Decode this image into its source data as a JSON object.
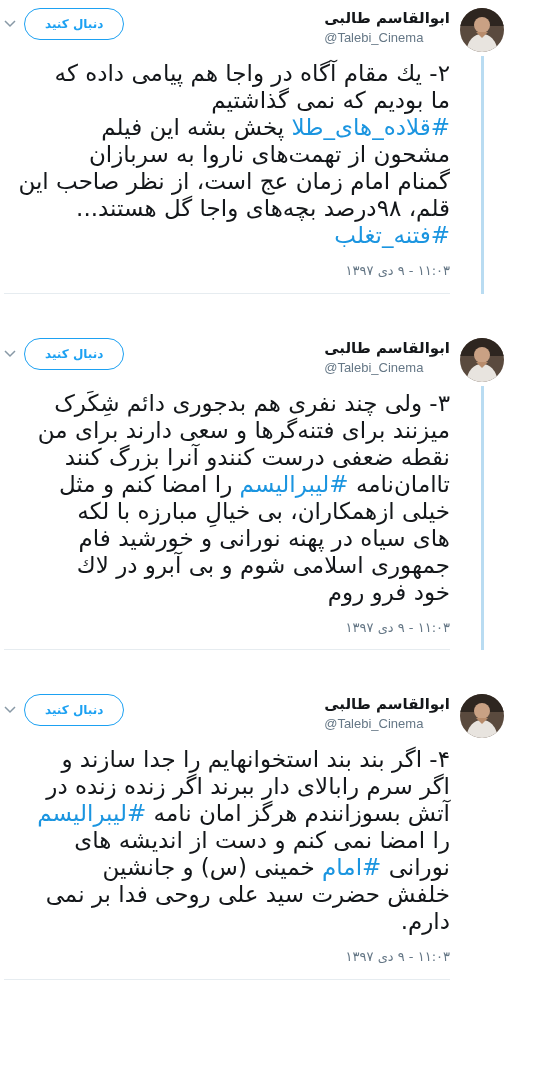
{
  "tweets": [
    {
      "author": {
        "name": "ابوالقاسم طالبی",
        "handle": "@Talebi_Cinema"
      },
      "follow_label": "دنبال کنید",
      "connected": true,
      "timestamp": "۱۱:۰۳ - ۹ دی ۱۳۹۷",
      "lines": [
        [
          {
            "kind": "text",
            "text": "٢- یك مقام آگاه در واجا هم پیامی داده که"
          }
        ],
        [
          {
            "kind": "text",
            "text": "ما بودیم که نمی گذاشتیم"
          }
        ],
        [
          {
            "kind": "hashtag",
            "text": "#قلاده_های_طلا"
          },
          {
            "kind": "text",
            "text": " پخش بشه این فیلم"
          }
        ],
        [
          {
            "kind": "text",
            "text": "مشحون از تهمت‌های ناروا به سربازان"
          }
        ],
        [
          {
            "kind": "text",
            "text": "گمنام امام زمان عج است، از نظر صاحب این"
          }
        ],
        [
          {
            "kind": "text",
            "text": "قلم، ۹۸درصد بچه‌های واجا گل هستند..."
          }
        ],
        [
          {
            "kind": "hashtag",
            "text": "#فتنه_تغلب"
          }
        ]
      ]
    },
    {
      "author": {
        "name": "ابوالقاسم طالبی",
        "handle": "@Talebi_Cinema"
      },
      "follow_label": "دنبال کنید",
      "connected": true,
      "timestamp": "۱۱:۰۳ - ۹ دی ۱۳۹۷",
      "lines": [
        [
          {
            "kind": "text",
            "text": "۳- ولی چند نفری هم بدجوری دائم شِکَرک"
          }
        ],
        [
          {
            "kind": "text",
            "text": "میزنند برای فتنه‌گرها و سعی دارند برای من"
          }
        ],
        [
          {
            "kind": "text",
            "text": "نقطه ضعفی درست کنندو آنرا بزرگ کنند"
          }
        ],
        [
          {
            "kind": "text",
            "text": "تاامان‌نامه "
          },
          {
            "kind": "hashtag",
            "text": "#لیبرالیسم"
          },
          {
            "kind": "text",
            "text": " را امضا کنم و مثل"
          }
        ],
        [
          {
            "kind": "text",
            "text": "خیلی ازهمکاران، بی خیالِ مبارزه با لکه"
          }
        ],
        [
          {
            "kind": "text",
            "text": "های سیاه در پهنه نورانی و خورشید فام"
          }
        ],
        [
          {
            "kind": "text",
            "text": "جمهوری اسلامی شوم و بی آبرو در لاك"
          }
        ],
        [
          {
            "kind": "text",
            "text": "خود فرو روم"
          }
        ]
      ]
    },
    {
      "author": {
        "name": "ابوالقاسم طالبی",
        "handle": "@Talebi_Cinema"
      },
      "follow_label": "دنبال کنید",
      "connected": false,
      "timestamp": "۱۱:۰۳ - ۹ دی ۱۳۹۷",
      "lines": [
        [
          {
            "kind": "text",
            "text": "۴- اگر بند بند استخوانهایم را جدا سازند و"
          }
        ],
        [
          {
            "kind": "text",
            "text": "اگر سرم رابالای دار ببرند اگر زنده زنده در"
          }
        ],
        [
          {
            "kind": "text",
            "text": "آتش بسوزانندم هرگز امان نامه "
          },
          {
            "kind": "hashtag",
            "text": "#لیبرالیسم"
          }
        ],
        [
          {
            "kind": "text",
            "text": "را امضا نمی کنم و دست از اندیشه های"
          }
        ],
        [
          {
            "kind": "text",
            "text": "نورانی "
          },
          {
            "kind": "hashtag",
            "text": "#امام"
          },
          {
            "kind": "text",
            "text": " خمینی (س) و جانشین"
          }
        ],
        [
          {
            "kind": "text",
            "text": "خلفش حضرت سید علی روحی فدا بر نمی"
          }
        ],
        [
          {
            "kind": "text",
            "text": "دارم."
          }
        ]
      ]
    }
  ]
}
